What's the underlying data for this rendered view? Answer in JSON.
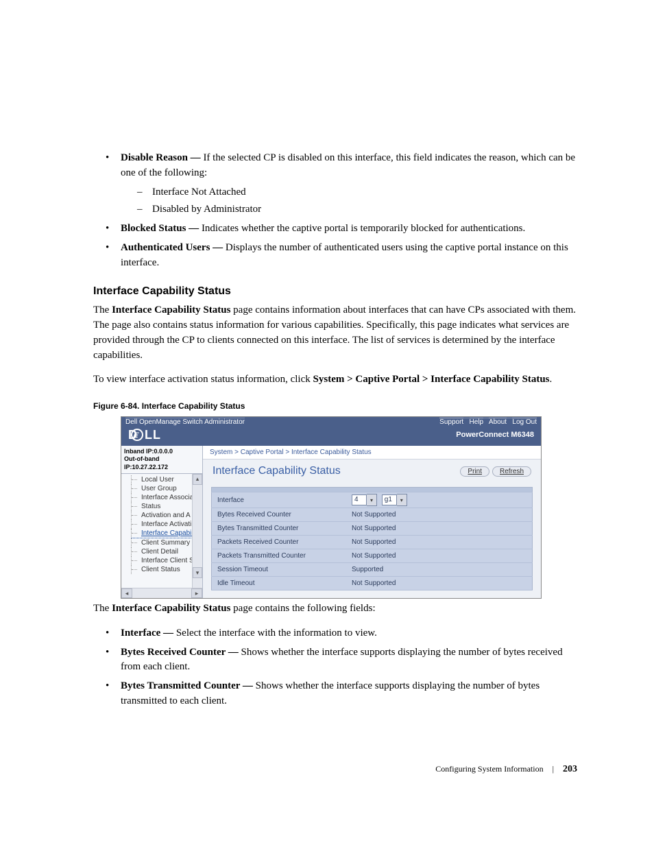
{
  "bullets": {
    "disable_reason": {
      "term": "Disable Reason — ",
      "desc": "If the selected CP is disabled on this interface, this field indicates the reason, which can be one of the following:",
      "subitems": [
        "Interface Not Attached",
        "Disabled by Administrator"
      ]
    },
    "blocked_status": {
      "term": "Blocked Status — ",
      "desc": "Indicates whether the captive portal is temporarily blocked for authentications."
    },
    "auth_users": {
      "term": "Authenticated Users — ",
      "desc": "Displays the number of authenticated users using the captive portal instance on this interface."
    }
  },
  "heading": "Interface Capability Status",
  "para1_a": "The ",
  "para1_b": "Interface Capability Status",
  "para1_c": " page contains information about interfaces that can have CPs associated with them. The page also contains status information for various capabilities. Specifically, this page indicates what services are provided through the CP to clients connected on this interface. The list of services is determined by the interface capabilities.",
  "para2_a": "To view interface activation status information, click ",
  "para2_b": "System > Captive Portal > Interface Capability Status",
  "para2_c": ".",
  "figure_caption": "Figure 6-84.    Interface Capability Status",
  "screenshot": {
    "titlebar_left": "Dell OpenManage Switch Administrator",
    "titlebar_links": [
      "Support",
      "Help",
      "About",
      "Log Out"
    ],
    "product": "PowerConnect M6348",
    "ip1": "Inband IP:0.0.0.0",
    "ip2": "Out-of-band IP:10.27.22.172",
    "tree": [
      "Local User",
      "User Group",
      "Interface Associa",
      "Status",
      "Activation and A",
      "Interface Activati",
      "Interface Capabil",
      "Client Summary",
      "Client Detail",
      "Interface Client S",
      "Client Status"
    ],
    "active_index": 6,
    "breadcrumb": "System > Captive Portal > Interface Capability Status",
    "title": "Interface Capability Status",
    "print": "Print",
    "refresh": "Refresh",
    "interface_sel": {
      "unit": "4",
      "port": "g1"
    },
    "rows": [
      {
        "label": "Interface",
        "value": ""
      },
      {
        "label": "Bytes Received Counter",
        "value": "Not Supported"
      },
      {
        "label": "Bytes Transmitted Counter",
        "value": "Not Supported"
      },
      {
        "label": "Packets Received Counter",
        "value": "Not Supported"
      },
      {
        "label": "Packets Transmitted Counter",
        "value": "Not Supported"
      },
      {
        "label": "Session Timeout",
        "value": "Supported"
      },
      {
        "label": "Idle Timeout",
        "value": "Not Supported"
      }
    ]
  },
  "para3_a": "The ",
  "para3_b": "Interface Capability Status",
  "para3_c": " page contains the following fields:",
  "bullets2": {
    "interface": {
      "term": "Interface — ",
      "desc": "Select the interface with the information to view."
    },
    "brc": {
      "term": "Bytes Received Counter — ",
      "desc": "Shows whether the interface supports displaying the number of bytes received from each client."
    },
    "btc": {
      "term": "Bytes Transmitted Counter — ",
      "desc": "Shows whether the interface supports displaying the number of bytes transmitted to each client."
    }
  },
  "footer": {
    "section": "Configuring System Information",
    "page": "203"
  }
}
